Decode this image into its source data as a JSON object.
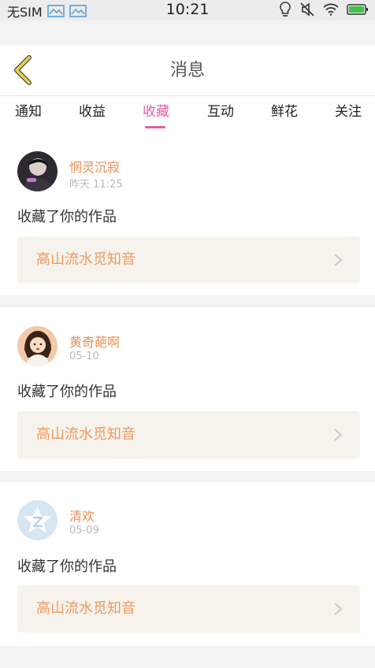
{
  "status_bar": {
    "carrier": "无SIM",
    "time": "10:21"
  },
  "header": {
    "title": "消息"
  },
  "tabs": [
    {
      "label": "通知"
    },
    {
      "label": "收益"
    },
    {
      "label": "收藏"
    },
    {
      "label": "互动"
    },
    {
      "label": "鲜花"
    },
    {
      "label": "关注"
    }
  ],
  "active_tab": "收藏",
  "messages": [
    {
      "user": "惘灵沉寂",
      "time": "昨天 11:25",
      "action": "收藏了你的作品",
      "work": "高山流水觅知音"
    },
    {
      "user": "黄奇葩啊",
      "time": "05-10",
      "action": "收藏了你的作品",
      "work": "高山流水觅知音"
    },
    {
      "user": "清欢",
      "time": "05-09",
      "action": "收藏了你的作品",
      "work": "高山流水觅知音"
    }
  ],
  "colors": {
    "accent": "#e0609c",
    "username": "#e99055",
    "work_title": "#ee9a62",
    "back_arrow": "#e9d34a"
  }
}
